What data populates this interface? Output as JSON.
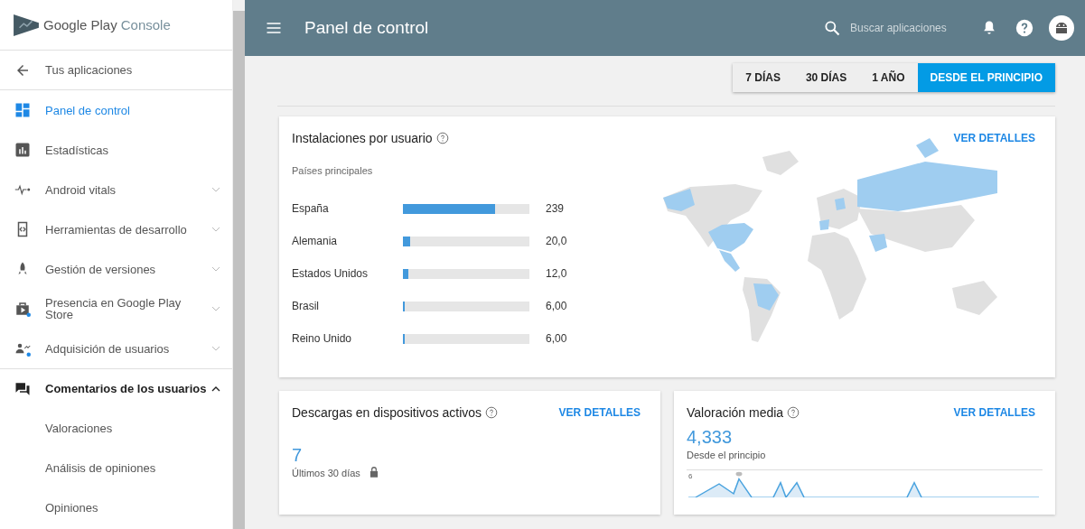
{
  "sidebar": {
    "brand": {
      "name": "Google Play",
      "suffix": "Console"
    },
    "back": {
      "label": "Tus aplicaciones"
    },
    "items": [
      {
        "label": "Panel de control",
        "kind": "dashboard",
        "selected": true,
        "expandable": false,
        "expanded": false,
        "dot": false,
        "section_start": false
      },
      {
        "label": "Estadísticas",
        "kind": "stats",
        "selected": false,
        "expandable": false,
        "expanded": false,
        "dot": false,
        "section_start": false
      },
      {
        "label": "Android vitals",
        "kind": "vitals",
        "selected": false,
        "expandable": true,
        "expanded": false,
        "dot": false,
        "section_start": false
      },
      {
        "label": "Herramientas de desarrollo",
        "kind": "tools",
        "selected": false,
        "expandable": true,
        "expanded": false,
        "dot": false,
        "section_start": false
      },
      {
        "label": "Gestión de versiones",
        "kind": "rocket",
        "selected": false,
        "expandable": true,
        "expanded": false,
        "dot": false,
        "section_start": false
      },
      {
        "label": "Presencia en Google Play Store",
        "kind": "store",
        "selected": false,
        "expandable": true,
        "expanded": false,
        "dot": true,
        "section_start": false
      },
      {
        "label": "Adquisición de usuarios",
        "kind": "users",
        "selected": false,
        "expandable": true,
        "expanded": false,
        "dot": true,
        "section_start": false
      },
      {
        "label": "Comentarios de los usuarios",
        "kind": "comments",
        "selected": false,
        "expandable": true,
        "expanded": true,
        "dot": false,
        "section_start": true,
        "children": [
          {
            "label": "Valoraciones",
            "selected": false
          },
          {
            "label": "Análisis de opiniones",
            "selected": false
          },
          {
            "label": "Opiniones",
            "selected": false
          }
        ]
      }
    ]
  },
  "topbar": {
    "title": "Panel de control",
    "search": {
      "placeholder": "Buscar aplicaciones"
    }
  },
  "ranges": [
    {
      "label": "7 DÍAS",
      "selected": false
    },
    {
      "label": "30 DÍAS",
      "selected": false
    },
    {
      "label": "1 AÑO",
      "selected": false
    },
    {
      "label": "DESDE EL PRINCIPIO",
      "selected": true
    }
  ],
  "installs_card": {
    "title": "Instalaciones por usuario",
    "link": "VER DETALLES",
    "subtitle": "Países principales",
    "countries": [
      {
        "name": "España",
        "level": 0.73,
        "value": "239"
      },
      {
        "name": "Alemania",
        "level": 0.06,
        "value": "20,0"
      },
      {
        "name": "Estados Unidos",
        "level": 0.04,
        "value": "12,0"
      },
      {
        "name": "Brasil",
        "level": 0.015,
        "value": "6,00"
      },
      {
        "name": "Reino Unido",
        "level": 0.015,
        "value": "6,00"
      }
    ]
  },
  "downloads_card": {
    "title": "Descargas en dispositivos activos",
    "link": "VER DETALLES",
    "value": "7",
    "caption": "Últimos 30 días",
    "locked": true
  },
  "rating_card": {
    "title": "Valoración media",
    "link": "VER DETALLES",
    "value": "4,333",
    "caption": "Desde el principio",
    "chart_tick": "6"
  }
}
